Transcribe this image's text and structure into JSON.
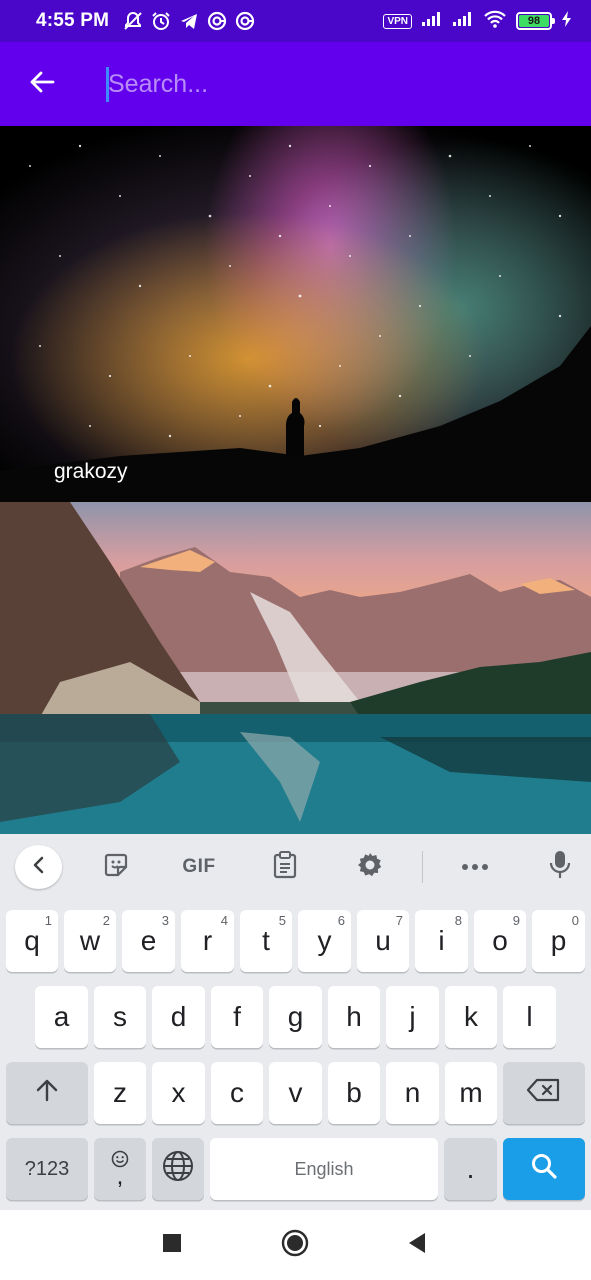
{
  "status_bar": {
    "time": "4:55 PM",
    "vpn_label": "VPN",
    "battery_level": "98",
    "left_icons": [
      "mute-bell-icon",
      "alarm-icon",
      "telegram-icon",
      "vpn-circle-icon",
      "vpn-circle-icon"
    ],
    "right_icons": [
      "signal-icon",
      "signal-icon",
      "wifi-icon",
      "charging-icon"
    ]
  },
  "app_bar": {
    "back_icon": "arrow-left-icon",
    "search": {
      "placeholder": "Search...",
      "value": ""
    },
    "accent_color": "#6200ee"
  },
  "results": [
    {
      "author": "grakozy",
      "image": "night-sky-milky-way"
    },
    {
      "author": "",
      "image": "mountain-lake-sunset"
    }
  ],
  "keyboard": {
    "toolbar": {
      "collapse_icon": "chevron-left-icon",
      "sticker_icon": "sticker-icon",
      "gif_label": "GIF",
      "clipboard_icon": "clipboard-icon",
      "settings_icon": "gear-icon",
      "more_icon": "more-horizontal-icon",
      "mic_icon": "microphone-icon"
    },
    "row1": [
      {
        "k": "q",
        "h": "1"
      },
      {
        "k": "w",
        "h": "2"
      },
      {
        "k": "e",
        "h": "3"
      },
      {
        "k": "r",
        "h": "4"
      },
      {
        "k": "t",
        "h": "5"
      },
      {
        "k": "y",
        "h": "6"
      },
      {
        "k": "u",
        "h": "7"
      },
      {
        "k": "i",
        "h": "8"
      },
      {
        "k": "o",
        "h": "9"
      },
      {
        "k": "p",
        "h": "0"
      }
    ],
    "row2": [
      "a",
      "s",
      "d",
      "f",
      "g",
      "h",
      "j",
      "k",
      "l"
    ],
    "row3": [
      "z",
      "x",
      "c",
      "v",
      "b",
      "n",
      "m"
    ],
    "bottom": {
      "symbols_label": "?123",
      "emoji_comma": ",",
      "space_label": "English",
      "period": "."
    },
    "search_key_color": "#1a9ee8"
  },
  "nav_bar": {
    "icons": [
      "recents-square-icon",
      "home-circle-icon",
      "back-triangle-icon"
    ]
  }
}
